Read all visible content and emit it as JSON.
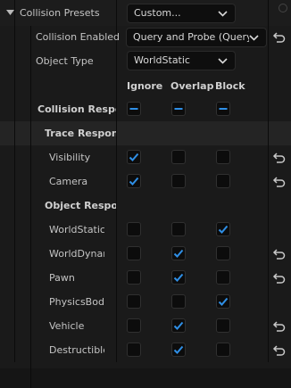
{
  "collision_presets": {
    "label": "Collision Presets",
    "value": "Custom..."
  },
  "collision_enabled": {
    "label": "Collision Enabled",
    "value": "Query and Probe (Query"
  },
  "object_type": {
    "label": "Object Type",
    "value": "WorldStatic"
  },
  "columns": [
    "Ignore",
    "Overlap",
    "Block"
  ],
  "collision_responses": {
    "label": "Collision Respons",
    "state": [
      "indeterminate",
      "indeterminate",
      "indeterminate"
    ]
  },
  "trace_responses": {
    "label": "Trace Respon",
    "rows": [
      {
        "label": "Visibility",
        "checked": [
          true,
          false,
          false
        ],
        "reset": true
      },
      {
        "label": "Camera",
        "checked": [
          true,
          false,
          false
        ],
        "reset": true
      }
    ]
  },
  "object_responses": {
    "label": "Object Respo",
    "rows": [
      {
        "label": "WorldStatic",
        "checked": [
          false,
          false,
          true
        ],
        "reset": false
      },
      {
        "label": "WorldDynan",
        "checked": [
          false,
          true,
          false
        ],
        "reset": true
      },
      {
        "label": "Pawn",
        "checked": [
          false,
          true,
          false
        ],
        "reset": true
      },
      {
        "label": "PhysicsBod",
        "checked": [
          false,
          false,
          true
        ],
        "reset": false
      },
      {
        "label": "Vehicle",
        "checked": [
          false,
          true,
          false
        ],
        "reset": true
      },
      {
        "label": "Destructible",
        "checked": [
          false,
          true,
          false
        ],
        "reset": true
      }
    ]
  },
  "colors": {
    "accent": "#2f8fe6",
    "check": "#e6e6e6",
    "bg": "#151515"
  }
}
